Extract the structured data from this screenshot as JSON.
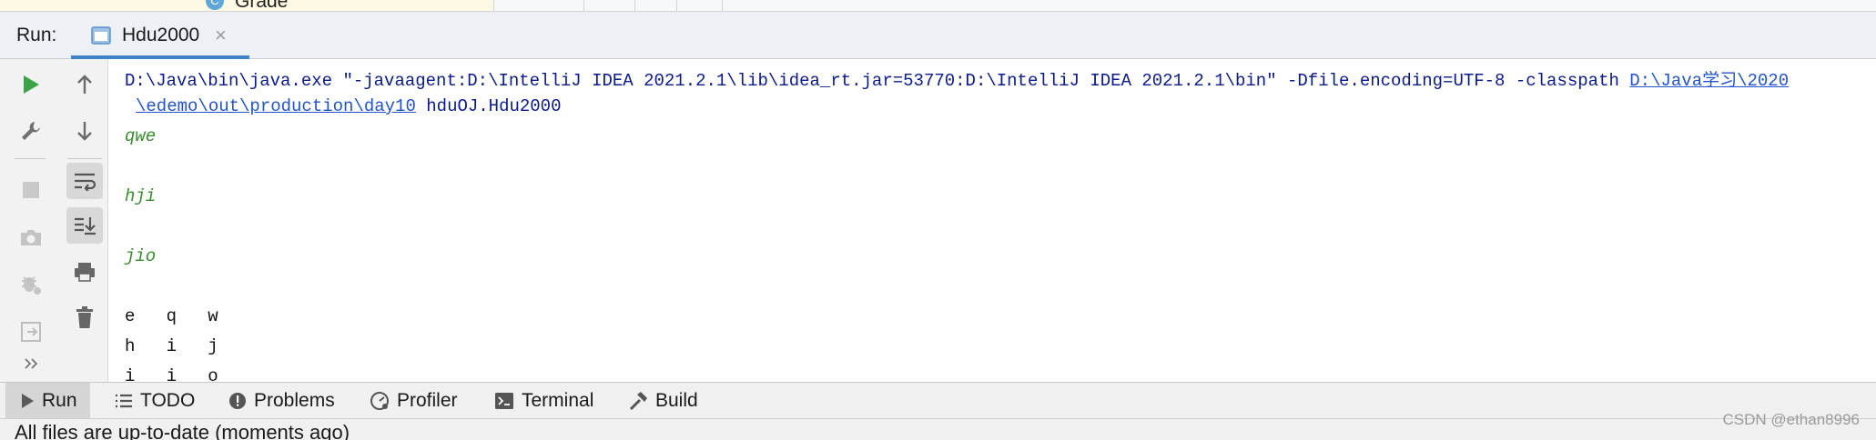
{
  "top_strip": {
    "class_badge": "C",
    "file_label": "Grade"
  },
  "run_panel": {
    "label": "Run:",
    "tab_title": "Hdu2000",
    "tab_close": "×"
  },
  "console": {
    "cmd_line1_text": "D:\\Java\\bin\\java.exe \"-javaagent:D:\\IntelliJ IDEA 2021.2.1\\lib\\idea_rt.jar=53770:D:\\IntelliJ IDEA 2021.2.1\\bin\" -Dfile.encoding=UTF-8 -classpath ",
    "cmd_line1_link": "D:\\Java学习\\2020",
    "cmd_line2_link": "\\edemo\\out\\production\\day10",
    "cmd_line2_text": " hduOJ.Hdu2000",
    "user_inputs": [
      "qwe",
      "hji",
      "jio"
    ],
    "output_lines": [
      "e   q   w",
      "h   i   j",
      "i   i   o"
    ]
  },
  "bottom_tabs": [
    {
      "label": "Run"
    },
    {
      "label": "TODO"
    },
    {
      "label": "Problems"
    },
    {
      "label": "Profiler"
    },
    {
      "label": "Terminal"
    },
    {
      "label": "Build"
    }
  ],
  "status": {
    "text": "All files are up-to-date (moments ago)"
  },
  "watermark": "CSDN @ethan8996",
  "colors": {
    "accent": "#4083c9",
    "run_green": "#3aa346",
    "input_green": "#3a8d2f",
    "link_blue": "#2253cc"
  }
}
